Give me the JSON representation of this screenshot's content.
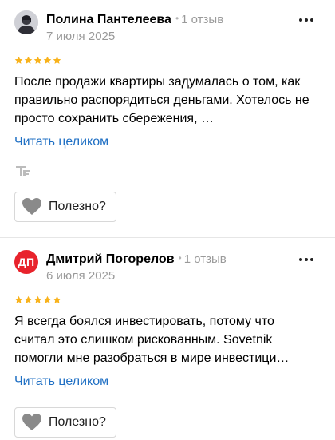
{
  "reviews": [
    {
      "author": "Полина Пантелеева",
      "review_count": "1 отзыв",
      "date": "7 июля 2025",
      "avatar_type": "photo",
      "avatar_initials": "",
      "rating": 5,
      "text": "После продажи квартиры задумалась о том, как правильно распорядиться деньгами. Хотелось не просто сохранить сбережения, …",
      "read_more_label": "Читать целиком",
      "helpful_label": "Полезно?"
    },
    {
      "author": "Дмитрий Погорелов",
      "review_count": "1 отзыв",
      "date": "6 июля 2025",
      "avatar_type": "initials",
      "avatar_initials": "ДП",
      "rating": 5,
      "text": "Я всегда боялся инвестировать, потому что считал это слишком рискованным. Sovetnik помогли мне разобраться в мире инвестици…",
      "read_more_label": "Читать целиком",
      "helpful_label": "Полезно?"
    }
  ],
  "colors": {
    "star": "#f8b21b",
    "link": "#2070c4",
    "muted": "#9a9a9a",
    "initials_avatar": "#e8232c",
    "heart": "#8a8a8a",
    "border": "#d8d8d8"
  },
  "icons": {
    "more": "more-dots-icon",
    "star": "star-icon",
    "heart": "heart-icon",
    "source_logo": "tf-logo-icon"
  }
}
